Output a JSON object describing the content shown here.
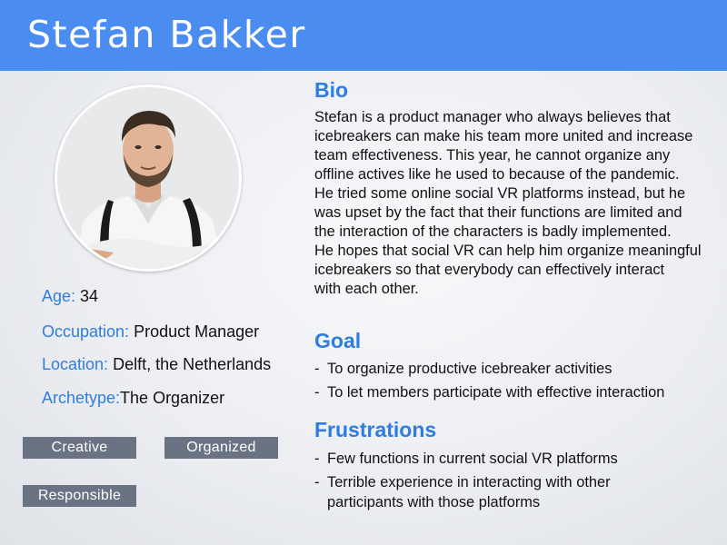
{
  "name": "Stefan Bakker",
  "avatar_icon": "person-portrait-icon",
  "info": {
    "age_label": "Age:",
    "age_value": "34",
    "occupation_label": "Occupation:",
    "occupation_value": "Product Manager",
    "location_label": "Location:",
    "location_value": "Delft, the Netherlands",
    "archetype_label": "Archetype:",
    "archetype_value": "The Organizer"
  },
  "tags": [
    "Creative",
    "Organized",
    "Responsible"
  ],
  "bio": {
    "title": "Bio",
    "lines": [
      "Stefan is a product manager who always believes that",
      "icebreakers can make his team more united and increase",
      "team effectiveness. This year, he cannot organize any",
      "offline actives like he used to because of the pandemic.",
      "He tried some online social VR platforms instead, but he",
      "was upset by the fact that their functions are limited and",
      "the interaction of the characters is badly implemented.",
      "He hopes that social VR can help him organize meaningful",
      "icebreakers so that everybody can effectively interact",
      "with each other."
    ]
  },
  "goal": {
    "title": "Goal",
    "items": [
      "To organize productive icebreaker activities",
      "To let members participate with effective interaction"
    ]
  },
  "frustrations": {
    "title": "Frustrations",
    "items": [
      "Few functions in current social VR platforms",
      "Terrible experience in interacting with other"
    ],
    "item_2_cont": "participants with those platforms"
  },
  "colors": {
    "header": "#4a8cf0",
    "accent": "#2f7de0",
    "tag": "#6a7383"
  }
}
